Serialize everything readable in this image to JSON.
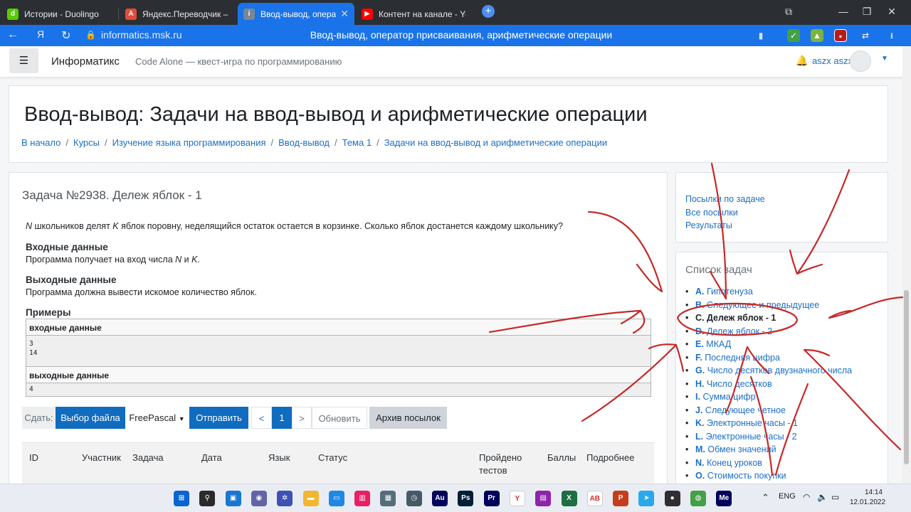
{
  "browser": {
    "tabs": [
      {
        "label": "Истории - Duolingo",
        "icon": "duolingo-icon",
        "color": "#58cc02"
      },
      {
        "label": "Яндекс.Переводчик – сло",
        "icon": "yandex-translate-icon",
        "color": "#e24b3a"
      },
      {
        "label": "Ввод-вывод, оператор",
        "icon": "informatics-icon",
        "color": "#7a8793",
        "active": true
      },
      {
        "label": "Контент на канале - YouTu",
        "icon": "youtube-icon",
        "color": "#ff0000"
      }
    ],
    "url": "informatics.msk.ru",
    "page_title": "Ввод-вывод, оператор присваивания, арифметические операции"
  },
  "navbar": {
    "menu_icon": "hamburger-icon",
    "brand": "Информатикс",
    "tagline": "Code Alone — квест-игра по программированию",
    "username": "aszx aszx"
  },
  "header": {
    "title": "Ввод-вывод: Задачи на ввод-вывод и арифметические операции",
    "breadcrumb": [
      "В начало",
      "Курсы",
      "Изучение языка программирования",
      "Ввод-вывод",
      "Тема 1",
      "Задачи на ввод-вывод и арифметические операции"
    ]
  },
  "problem": {
    "title": "Задача №2938. Дележ яблок - 1",
    "statement": {
      "var_n": "N",
      "part1": " школьников делят ",
      "var_k": "K",
      "part2": " яблок поровну, неделящийся остаток остается в корзинке. Сколько яблок достанется каждому школьнику?"
    },
    "input_heading": "Входные данные",
    "input_text": {
      "part1": "Программа получает на вход числа ",
      "var_n": "N",
      "and": " и ",
      "var_k": "K",
      "dot": "."
    },
    "output_heading": "Выходные данные",
    "output_text": "Программа должна вывести искомое количество яблок.",
    "examples_heading": "Примеры",
    "example": {
      "input_label": "входные данные",
      "input_value": "3\n14",
      "output_label": "выходные данные",
      "output_value": "4"
    }
  },
  "submit": {
    "label": "Сдать:",
    "choose_file": "Выбор файла",
    "language": "FreePascal",
    "send": "Отправить",
    "prev": "<",
    "page": "1",
    "next": ">",
    "refresh": "Обновить",
    "archive": "Архив посылок"
  },
  "history_table": {
    "headers": [
      "ID",
      "Участник",
      "Задача",
      "Дата",
      "Язык",
      "Статус",
      "Пройдено тестов",
      "Баллы",
      "Подробнее"
    ]
  },
  "sidebar": {
    "links": [
      "Посылки по задаче",
      "Все посылки",
      "Результаты"
    ],
    "problems_title": "Список задач",
    "problems": [
      {
        "letter": "A.",
        "name": "Гипотенуза"
      },
      {
        "letter": "B.",
        "name": "Следующее и предыдущее"
      },
      {
        "letter": "C.",
        "name": "Дележ яблок - 1",
        "current": true
      },
      {
        "letter": "D.",
        "name": "Дележ яблок - 2"
      },
      {
        "letter": "E.",
        "name": "МКАД"
      },
      {
        "letter": "F.",
        "name": "Последняя цифра"
      },
      {
        "letter": "G.",
        "name": "Число десятков двузначного числа"
      },
      {
        "letter": "H.",
        "name": "Число десятков"
      },
      {
        "letter": "I.",
        "name": "Сумма цифр"
      },
      {
        "letter": "J.",
        "name": "Следующее четное"
      },
      {
        "letter": "K.",
        "name": "Электронные часы - 1"
      },
      {
        "letter": "L.",
        "name": "Электронные часы - 2"
      },
      {
        "letter": "M.",
        "name": "Обмен значений"
      },
      {
        "letter": "N.",
        "name": "Конец уроков"
      },
      {
        "letter": "O.",
        "name": "Стоимость покупки"
      }
    ]
  },
  "annotation": {
    "color": "#c62828"
  },
  "taskbar": {
    "lang": "ENG",
    "time": "14:14",
    "date": "12.01.2022",
    "apps": [
      {
        "name": "windows-start-icon",
        "color": "#0a64d2",
        "text": "⊞"
      },
      {
        "name": "search-icon",
        "color": "#2a2a2a",
        "text": "⚲"
      },
      {
        "name": "task-view-icon",
        "color": "#1976d2",
        "text": "▣"
      },
      {
        "name": "chat-icon",
        "color": "#6264a7",
        "text": "◉"
      },
      {
        "name": "widgets-icon",
        "color": "#3f51b5",
        "text": "✲"
      },
      {
        "name": "file-explorer-icon",
        "color": "#f2b632",
        "text": "▬"
      },
      {
        "name": "monitor-icon",
        "color": "#1e88e5",
        "text": "▭"
      },
      {
        "name": "color-app-icon",
        "color": "#e91e63",
        "text": "▥"
      },
      {
        "name": "calculator-icon",
        "color": "#546e7a",
        "text": "▦"
      },
      {
        "name": "clock-app-icon",
        "color": "#455a64",
        "text": "◷"
      },
      {
        "name": "audition-icon",
        "color": "#00005b",
        "text": "Au"
      },
      {
        "name": "photoshop-icon",
        "color": "#001e36",
        "text": "Ps"
      },
      {
        "name": "premiere-icon",
        "color": "#00005b",
        "text": "Pr"
      },
      {
        "name": "yandex-browser-icon",
        "color": "#ffffff",
        "text": "Y"
      },
      {
        "name": "winrar-icon",
        "color": "#8e24aa",
        "text": "▤"
      },
      {
        "name": "excel-icon",
        "color": "#1d6f42",
        "text": "X"
      },
      {
        "name": "abbyy-icon",
        "color": "#ffffff",
        "text": "AB"
      },
      {
        "name": "powerpoint-icon",
        "color": "#c43e1c",
        "text": "P"
      },
      {
        "name": "telegram-icon",
        "color": "#29a9eb",
        "text": "➤"
      },
      {
        "name": "obs-icon",
        "color": "#302e31",
        "text": "●"
      },
      {
        "name": "globe-app-icon",
        "color": "#43a047",
        "text": "◍"
      },
      {
        "name": "media-encoder-icon",
        "color": "#00005b",
        "text": "Me"
      }
    ]
  }
}
